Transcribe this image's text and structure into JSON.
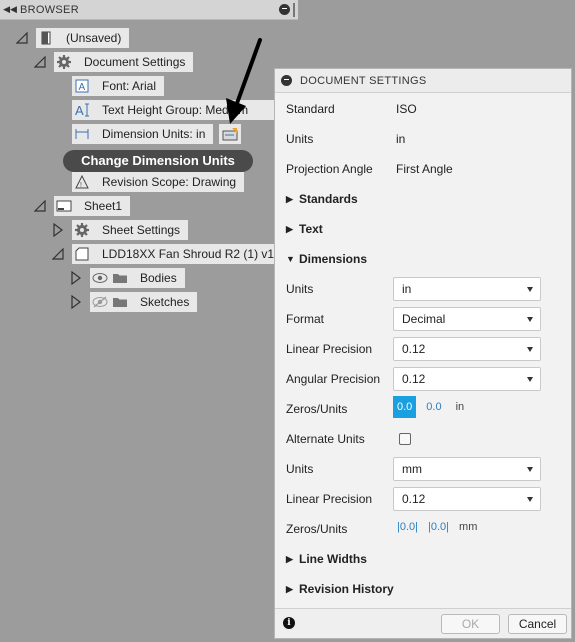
{
  "browser": {
    "title": "BROWSER",
    "collapse_glyph": "◀◀",
    "tree": {
      "root": "(Unsaved)",
      "document_settings": "Document Settings",
      "font": "Font: Arial",
      "text_height_group": "Text Height Group: Medium",
      "dimension_units": "Dimension Units: in",
      "revision_scope": "Revision Scope: Drawing",
      "sheet1": "Sheet1",
      "sheet_settings": "Sheet Settings",
      "component": "LDD18XX Fan Shroud R2 (1) v1",
      "bodies": "Bodies",
      "sketches": "Sketches"
    }
  },
  "tooltip": {
    "text": "Change Dimension Units"
  },
  "panel": {
    "title": "DOCUMENT SETTINGS",
    "standard": {
      "label": "Standard",
      "value": "ISO"
    },
    "units": {
      "label": "Units",
      "value": "in"
    },
    "projection": {
      "label": "Projection Angle",
      "value": "First Angle"
    },
    "sections": {
      "standards": "Standards",
      "text": "Text",
      "dimensions": "Dimensions",
      "line_widths": "Line Widths",
      "revision_history": "Revision History"
    },
    "dimensions": {
      "units_label": "Units",
      "units_value": "in",
      "format_label": "Format",
      "format_value": "Decimal",
      "linear_label": "Linear Precision",
      "linear_value": "0.12",
      "angular_label": "Angular Precision",
      "angular_value": "0.12",
      "zeros_label": "Zeros/Units",
      "zeros_a": "0.0",
      "zeros_b": "0.0",
      "zeros_unit": "in",
      "alt_units_label": "Alternate Units",
      "alt_units_label2": "Units",
      "alt_units_value": "mm",
      "alt_linear_label": "Linear Precision",
      "alt_linear_value": "0.12",
      "alt_zeros_label": "Zeros/Units",
      "alt_zeros_a": "|0.0|",
      "alt_zeros_b": "|0.0|",
      "alt_zeros_unit": "mm"
    },
    "footer": {
      "ok": "OK",
      "cancel": "Cancel",
      "info_glyph": "i"
    }
  },
  "colors": {
    "accent": "#1aa0e0",
    "tooltip_bg": "#4a4a4a",
    "backdrop": "#9c9c9c"
  }
}
